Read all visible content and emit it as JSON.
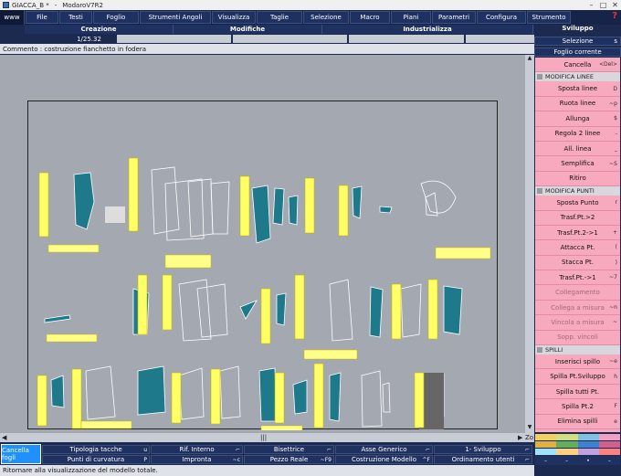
{
  "window": {
    "title": "GIACCA_B *",
    "app": "ModaroV7R2"
  },
  "menu": {
    "www": "www",
    "items": [
      "File",
      "Testi",
      "Foglio",
      "Strumenti Angoli",
      "Visualizza",
      "Taglie",
      "Selezione",
      "Macro",
      "Piani",
      "Parametri",
      "Configura",
      "Strumento"
    ],
    "help": "?"
  },
  "header": {
    "creazione": "Creazione",
    "modifiche": "Modifiche",
    "industrializza": "Industrializza",
    "sviluppo": "Sviluppo",
    "scale": "1/25.32"
  },
  "comment": "Commento : costruzione fianchetto in fodera",
  "side": {
    "selezione": "Selezione",
    "selezione_key": "s",
    "foglio_corrente": "Foglio corrente"
  },
  "panel": [
    {
      "type": "item",
      "label": "Cancella",
      "key": "<Del>"
    },
    {
      "type": "section",
      "label": "MODIFICA LINEE"
    },
    {
      "type": "item",
      "label": "Sposta linee",
      "key": "D"
    },
    {
      "type": "item",
      "label": "Ruota linee",
      "key": "~p"
    },
    {
      "type": "item",
      "label": "Allunga",
      "key": "$"
    },
    {
      "type": "item",
      "label": "Regola 2 linee",
      "key": "-"
    },
    {
      "type": "item",
      "label": "All. linea",
      "key": "_"
    },
    {
      "type": "item",
      "label": "Semplifica",
      "key": "~S"
    },
    {
      "type": "item",
      "label": "Ritiro",
      "key": ""
    },
    {
      "type": "section",
      "label": "MODIFICA PUNTI"
    },
    {
      "type": "item",
      "label": "Sposta Punto",
      "key": "r"
    },
    {
      "type": "item",
      "label": "Trasf.Pt.>2",
      "key": ""
    },
    {
      "type": "item",
      "label": "Trasf.Pt.2->1",
      "key": "+"
    },
    {
      "type": "item",
      "label": "Attacca Pt.",
      "key": "("
    },
    {
      "type": "item",
      "label": "Stacca Pt.",
      "key": ")"
    },
    {
      "type": "item",
      "label": "Trasf.Pt.->1",
      "key": "~7"
    },
    {
      "type": "disabled",
      "label": "Collegamento",
      "key": ""
    },
    {
      "type": "disabled",
      "label": "Collega a misura",
      "key": "~n"
    },
    {
      "type": "disabled",
      "label": "Vincola a misura",
      "key": "~"
    },
    {
      "type": "disabled",
      "label": "Sopp. vincoli",
      "key": ""
    },
    {
      "type": "section",
      "label": "SPILLI"
    },
    {
      "type": "item",
      "label": "Inserisci spillo",
      "key": "~e"
    },
    {
      "type": "item",
      "label": "Spilla Pt.Sviluppo",
      "key": "h"
    },
    {
      "type": "item",
      "label": "Spilla tutti Pt.",
      "key": ""
    },
    {
      "type": "item",
      "label": "Spilla Pt.2",
      "key": "F"
    },
    {
      "type": "item",
      "label": "Elimina spilli",
      "key": "e"
    }
  ],
  "bottom": {
    "cancella_fogli": "Cancella fogli",
    "row1": [
      {
        "label": "Tipologia tacche",
        "key": "u"
      },
      {
        "label": "Rif. Interno",
        "key": "⌐"
      },
      {
        "label": "Bisettrice",
        "key": "⌐"
      },
      {
        "label": "Asse Generico",
        "key": "⌐"
      },
      {
        "label": "1- Sviluppo",
        "key": "⌐"
      }
    ],
    "row2": [
      {
        "label": "Punti di curvatura",
        "key": "P"
      },
      {
        "label": "Impronta",
        "key": "~c"
      },
      {
        "label": "Pezzo Reale",
        "key": "~F9"
      },
      {
        "label": "Costruzione Modello",
        "key": "^F"
      },
      {
        "label": "Ordinamento utenti",
        "key": "⌐"
      }
    ]
  },
  "hscroll": {
    "zoom": "Zo"
  },
  "status": "Ritornare alla visualizzazione del modello totale.",
  "colors": {
    "accent_pink": "#f7a9bd",
    "piece_teal": "#1e7a8a",
    "menubar": "#162449",
    "tag_yellow": "#ffff66",
    "cancella_blue": "#1e90ff"
  }
}
